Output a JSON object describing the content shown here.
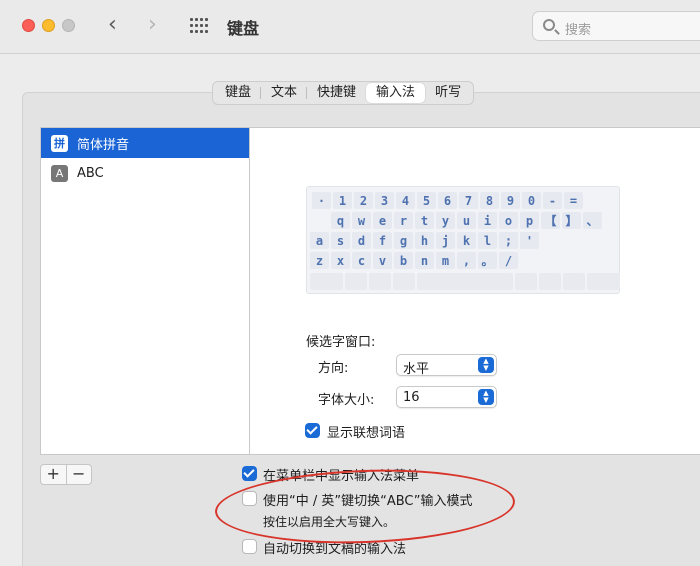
{
  "window": {
    "title": "键盘"
  },
  "search": {
    "placeholder": "搜索"
  },
  "tabs": [
    {
      "label": "键盘"
    },
    {
      "label": "文本"
    },
    {
      "label": "快捷键"
    },
    {
      "label": "输入法",
      "active": true
    },
    {
      "label": "听写"
    }
  ],
  "input_sources": [
    {
      "icon_text": "拼",
      "label": "简体拼音",
      "selected": true
    },
    {
      "icon_text": "A",
      "label": "ABC",
      "selected": false
    }
  ],
  "keyboard": {
    "rows": [
      [
        "·",
        "1",
        "2",
        "3",
        "4",
        "5",
        "6",
        "7",
        "8",
        "9",
        "0",
        "-",
        "="
      ],
      [
        "q",
        "w",
        "e",
        "r",
        "t",
        "y",
        "u",
        "i",
        "o",
        "p",
        "【",
        "】",
        "、"
      ],
      [
        "a",
        "s",
        "d",
        "f",
        "g",
        "h",
        "j",
        "k",
        "l",
        ";",
        "'"
      ],
      [
        "z",
        "x",
        "c",
        "v",
        "b",
        "n",
        "m",
        ",",
        "。",
        "/"
      ]
    ]
  },
  "candidate": {
    "heading": "候选字窗口:",
    "direction_label": "方向:",
    "direction_value": "水平",
    "fontsize_label": "字体大小:",
    "fontsize_value": "16"
  },
  "options": {
    "show_suggestions": {
      "label": "显示联想词语",
      "checked": true
    },
    "show_menu": {
      "label": "在菜单栏中显示输入法菜单",
      "checked": true
    },
    "ctrl_switch": {
      "label": "使用“中 / 英”键切换“ABC”输入模式",
      "checked": false,
      "hint": "按住以启用全大写键入。"
    },
    "auto_switch": {
      "label": "自动切换到文稿的输入法",
      "checked": false
    }
  },
  "buttons": {
    "add": "+",
    "remove": "−"
  },
  "colors": {
    "accent": "#1a6bd6",
    "annotation": "#d8342a"
  }
}
